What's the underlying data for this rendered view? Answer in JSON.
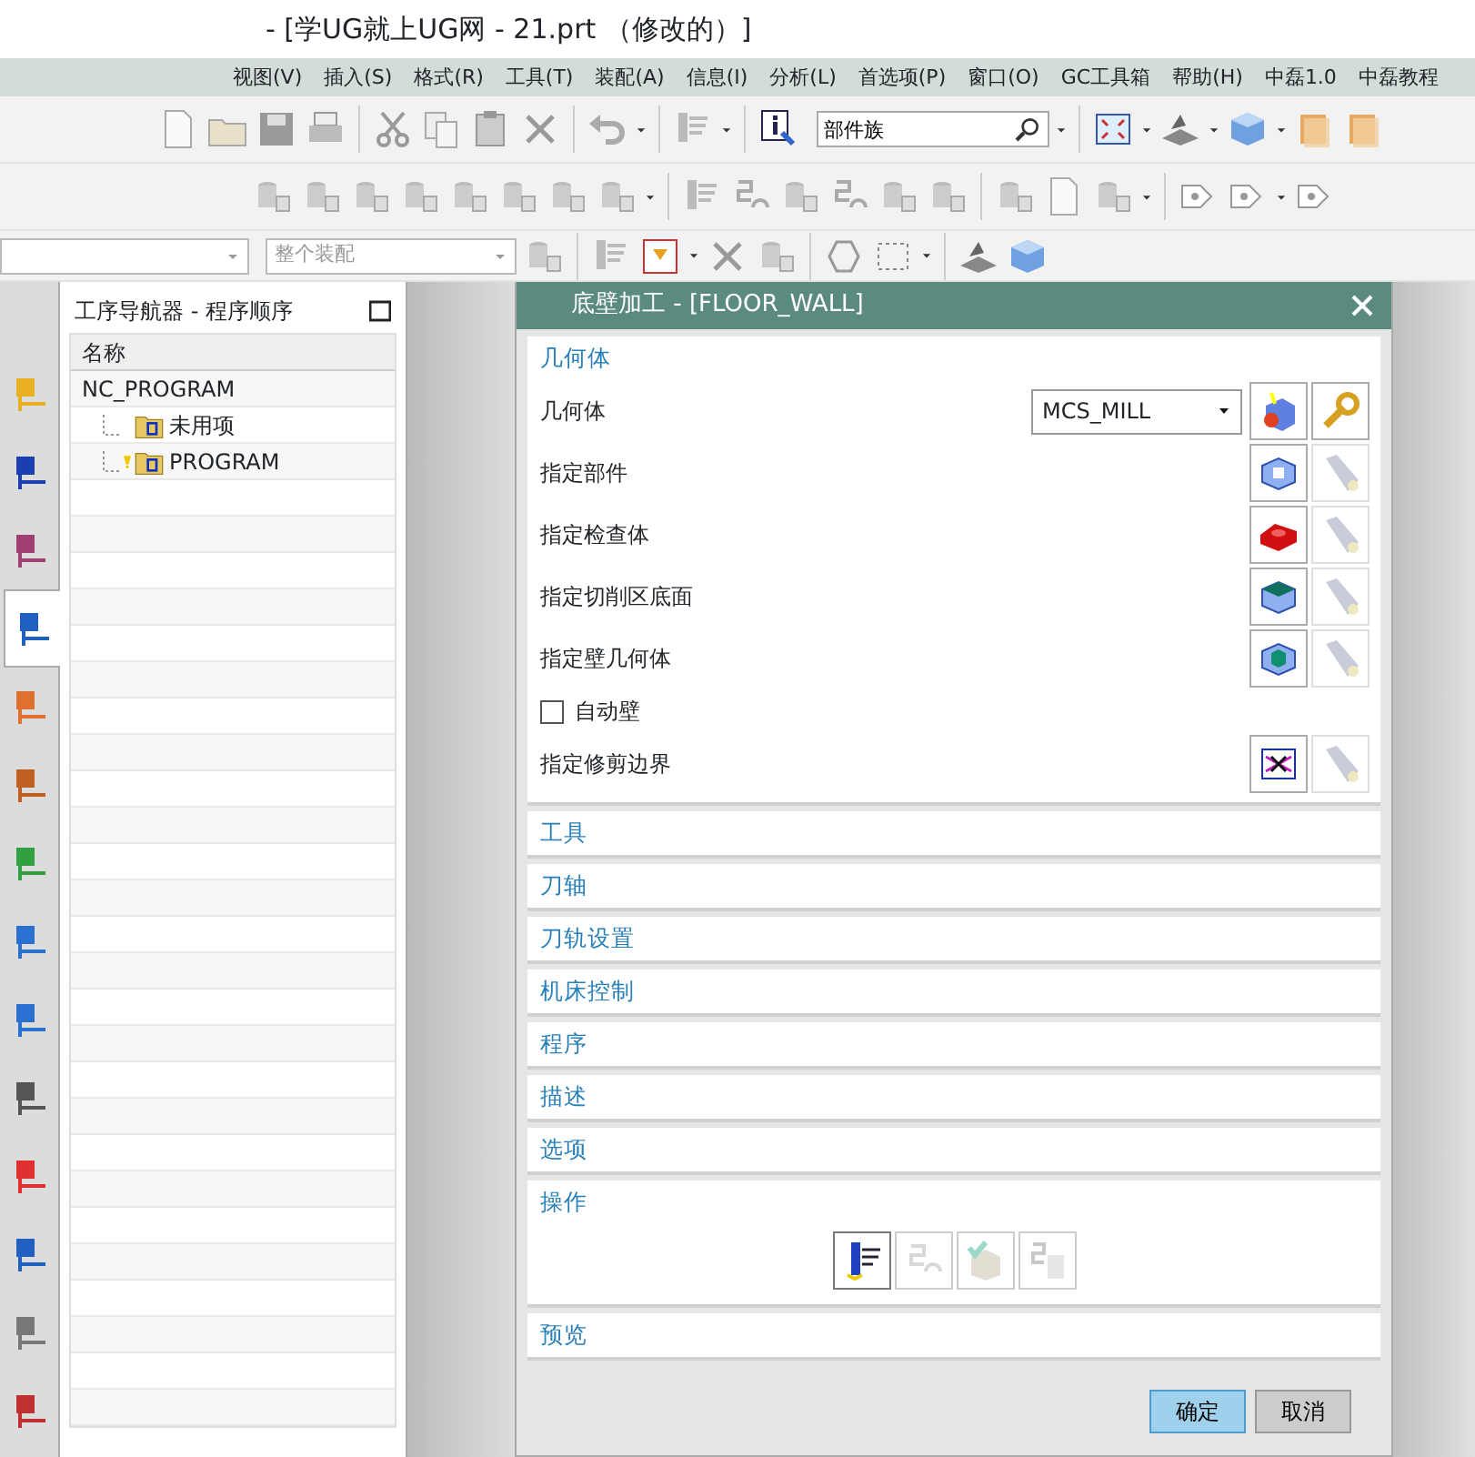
{
  "window": {
    "title": "- [学UG就上UG网 - 21.prt （修改的）]"
  },
  "menu": [
    "视图(V)",
    "插入(S)",
    "格式(R)",
    "工具(T)",
    "装配(A)",
    "信息(I)",
    "分析(L)",
    "首选项(P)",
    "窗口(O)",
    "GC工具箱",
    "帮助(H)",
    "中磊1.0",
    "中磊教程"
  ],
  "toolbar": {
    "search": {
      "value": "部件族"
    },
    "assembly_combo": {
      "value": "整个装配",
      "disabled": true
    }
  },
  "side_tabs": [
    {
      "selected": false
    },
    {
      "selected": false
    },
    {
      "selected": false
    },
    {
      "selected": true
    },
    {
      "selected": false
    },
    {
      "selected": false
    },
    {
      "selected": false
    },
    {
      "selected": false
    },
    {
      "selected": false
    },
    {
      "selected": false
    },
    {
      "selected": false
    },
    {
      "selected": false
    },
    {
      "selected": false
    },
    {
      "selected": false
    }
  ],
  "navigator": {
    "title": "工序导航器 - 程序顺序",
    "column": "名称",
    "tree": [
      {
        "label": "NC_PROGRAM",
        "children": [
          {
            "label": "未用项",
            "warning": false
          },
          {
            "label": "PROGRAM",
            "warning": true
          }
        ]
      }
    ]
  },
  "dialog": {
    "title": "底壁加工 - [FLOOR_WALL]",
    "geometry": {
      "heading": "几何体",
      "rows": [
        {
          "kind": "select",
          "label": "几何体",
          "value": "MCS_MILL"
        },
        {
          "kind": "pick",
          "label": "指定部件"
        },
        {
          "kind": "pick",
          "label": "指定检查体"
        },
        {
          "kind": "pick",
          "label": "指定切削区底面"
        },
        {
          "kind": "pick",
          "label": "指定壁几何体"
        },
        {
          "kind": "checkbox",
          "label": "自动壁",
          "checked": false
        },
        {
          "kind": "pick",
          "label": "指定修剪边界"
        }
      ]
    },
    "sections": [
      {
        "heading": "工具",
        "kind": "collapsed"
      },
      {
        "heading": "刀轴",
        "kind": "collapsed"
      },
      {
        "heading": "刀轨设置",
        "kind": "collapsed"
      },
      {
        "heading": "机床控制",
        "kind": "collapsed"
      },
      {
        "heading": "程序",
        "kind": "collapsed"
      },
      {
        "heading": "描述",
        "kind": "collapsed"
      },
      {
        "heading": "选项",
        "kind": "collapsed"
      },
      {
        "heading": "操作",
        "kind": "actions",
        "actions": [
          {
            "disabled": false
          },
          {
            "disabled": true
          },
          {
            "disabled": true
          },
          {
            "disabled": true
          }
        ]
      },
      {
        "heading": "预览",
        "kind": "collapsed"
      }
    ],
    "buttons": [
      {
        "label": "确定",
        "kind": "primary"
      },
      {
        "label": "取消",
        "kind": "secondary"
      }
    ]
  }
}
